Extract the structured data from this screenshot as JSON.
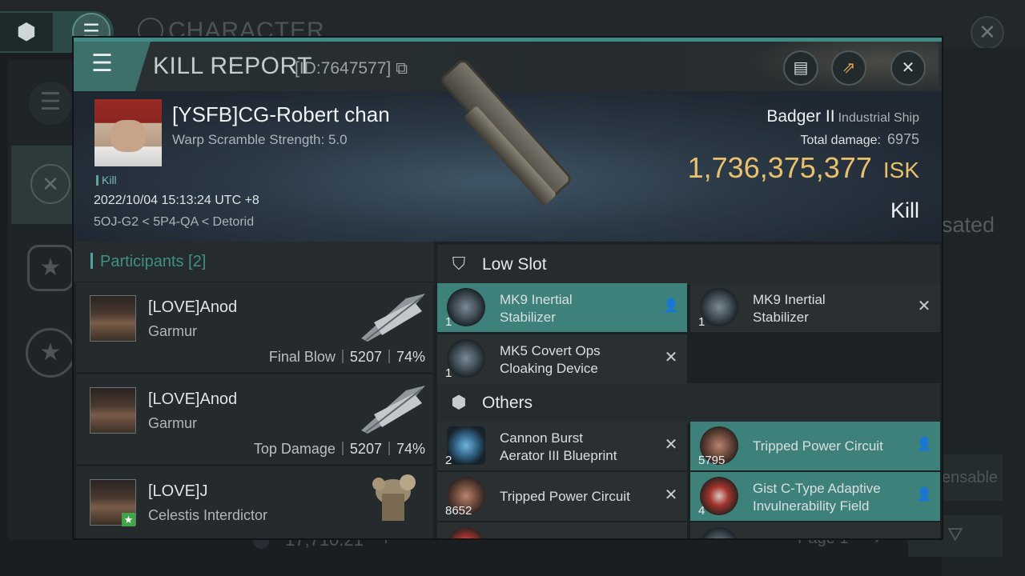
{
  "background": {
    "title": "CHARACTER",
    "right_text_1": "sated",
    "right_text_2": "ensable",
    "bottom_money": "17,710.21",
    "bottom_plus": "+",
    "page_label": "Page 1"
  },
  "modal": {
    "title": "KILL REPORT",
    "report_id": "[ID:7647577]",
    "icons": {
      "menu": "menu-icon",
      "copy": "copy-icon",
      "notes": "notes-icon",
      "share": "share-icon",
      "close": "close-icon"
    }
  },
  "victim": {
    "name": "[YSFB]CG-Robert chan",
    "warp_scramble": "Warp Scramble Strength: 5.0",
    "kill_tag": "Kill",
    "datetime": "2022/10/04 15:13:24 UTC +8",
    "location": "5OJ-G2 < 5P4-QA < Detorid",
    "ship_name": "Badger II",
    "ship_class": "Industrial Ship",
    "total_damage_label": "Total damage:",
    "total_damage": "6975",
    "isk_value": "1,736,375,377",
    "isk_unit": "ISK",
    "result": "Kill"
  },
  "participants": {
    "title": "Participants [2]",
    "rows": [
      {
        "name": "[LOVE]Anod",
        "ship": "Garmur",
        "role": "Final Blow",
        "damage": "5207",
        "percent": "74%"
      },
      {
        "name": "[LOVE]Anod",
        "ship": "Garmur",
        "role": "Top Damage",
        "damage": "5207",
        "percent": "74%"
      },
      {
        "name": "[LOVE]J",
        "ship": "Celestis Interdictor",
        "badge": "★"
      }
    ]
  },
  "sections": {
    "low_slot": {
      "title": "Low Slot",
      "items": [
        {
          "qty": "1",
          "name_1": "MK9 Inertial",
          "name_2": "Stabilizer",
          "mark": "person"
        },
        {
          "qty": "1",
          "name_1": "MK9 Inertial",
          "name_2": "Stabilizer",
          "mark": "destroyed"
        },
        {
          "qty": "1",
          "name_1": "MK5 Covert Ops",
          "name_2": "Cloaking Device",
          "mark": "destroyed"
        }
      ]
    },
    "others": {
      "title": "Others",
      "items": [
        {
          "qty": "2",
          "name_1": "Cannon Burst",
          "name_2": "Aerator III Blueprint",
          "mark": "destroyed"
        },
        {
          "qty": "5795",
          "name_1": "Tripped Power Circuit",
          "mark": "person"
        },
        {
          "qty": "8652",
          "name_1": "Tripped Power Circuit",
          "mark": "destroyed"
        },
        {
          "qty": "4",
          "name_1": "Gist C-Type Adaptive",
          "name_2": "Invulnerability Field",
          "mark": "person"
        }
      ]
    }
  },
  "marks": {
    "destroyed": "✕",
    "person": "👤"
  }
}
